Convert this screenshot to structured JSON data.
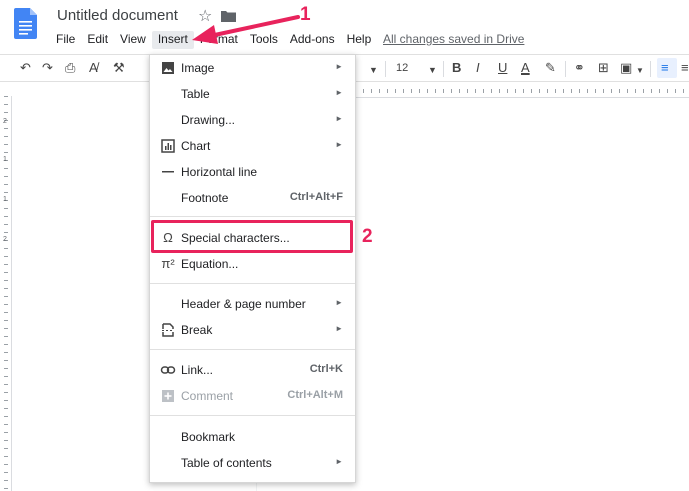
{
  "header": {
    "title": "Untitled document",
    "saved_status": "All changes saved in Drive"
  },
  "menubar": {
    "items": [
      "File",
      "Edit",
      "View",
      "Insert",
      "Format",
      "Tools",
      "Add-ons",
      "Help"
    ],
    "active": "Insert"
  },
  "toolbar": {
    "font_size": "12",
    "bold": "B",
    "italic": "I",
    "underline": "U",
    "text_color": "A"
  },
  "insert_menu": {
    "image": "Image",
    "table": "Table",
    "drawing": "Drawing...",
    "chart": "Chart",
    "horizontal_line": "Horizontal line",
    "footnote": "Footnote",
    "footnote_shortcut": "Ctrl+Alt+F",
    "special_characters": "Special characters...",
    "equation": "Equation...",
    "header_page_number": "Header & page number",
    "break": "Break",
    "link": "Link...",
    "link_shortcut": "Ctrl+K",
    "comment": "Comment",
    "comment_shortcut": "Ctrl+Alt+M",
    "bookmark": "Bookmark",
    "table_of_contents": "Table of contents"
  },
  "annotations": {
    "step1": "1",
    "step2": "2",
    "color": "#e8235c"
  },
  "vruler": [
    "2",
    "1",
    "1",
    "2"
  ]
}
